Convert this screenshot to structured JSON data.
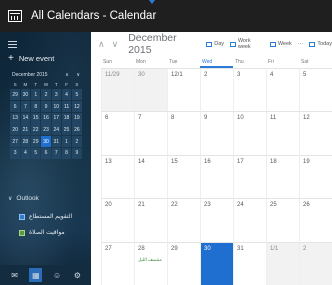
{
  "window": {
    "title": "All Calendars - Calendar"
  },
  "sidebar": {
    "new_event": "New event",
    "mini_calendar": {
      "month": "December 2015",
      "days_of_week": [
        "S",
        "M",
        "T",
        "W",
        "T",
        "F",
        "S"
      ],
      "dates": [
        "29",
        "30",
        "1",
        "2",
        "3",
        "4",
        "5",
        "6",
        "7",
        "8",
        "9",
        "10",
        "11",
        "12",
        "13",
        "14",
        "15",
        "16",
        "17",
        "18",
        "19",
        "20",
        "21",
        "22",
        "23",
        "24",
        "25",
        "26",
        "27",
        "28",
        "29",
        "30",
        "31",
        "1",
        "2",
        "3",
        "4",
        "5",
        "6",
        "7",
        "8",
        "9"
      ],
      "today_index": 31
    },
    "outlook_label": "Outlook",
    "calendars": [
      {
        "name": "التقويم المستطاع",
        "color": "#2f7bd2"
      },
      {
        "name": "مواقيت الصلاة",
        "color": "#5b9b3a"
      }
    ]
  },
  "toolbar": {
    "month_title": "December 2015",
    "buttons": [
      "Day",
      "Work week",
      "Week",
      "Today"
    ]
  },
  "grid": {
    "days_of_week": [
      "Sun",
      "Mon",
      "Tue",
      "Wed",
      "Thu",
      "Fri",
      "Sat"
    ],
    "selected_dow_index": 3,
    "weeks": [
      [
        "11/29",
        "30",
        "12/1",
        "2",
        "3",
        "4",
        "5"
      ],
      [
        "6",
        "7",
        "8",
        "9",
        "10",
        "11",
        "12"
      ],
      [
        "13",
        "14",
        "15",
        "16",
        "17",
        "18",
        "19"
      ],
      [
        "20",
        "21",
        "22",
        "23",
        "24",
        "25",
        "26"
      ],
      [
        "27",
        "28",
        "29",
        "30",
        "31",
        "1/1",
        "2"
      ]
    ],
    "other_month_cells": [
      0,
      1,
      33,
      34
    ],
    "today_cell": 31,
    "event_cell": 29,
    "event_text": "منتصف الليل"
  },
  "colors": {
    "accent": "#1f6fd0",
    "titlebar": "#1f1f1f",
    "sidebar": "#102a3e"
  }
}
